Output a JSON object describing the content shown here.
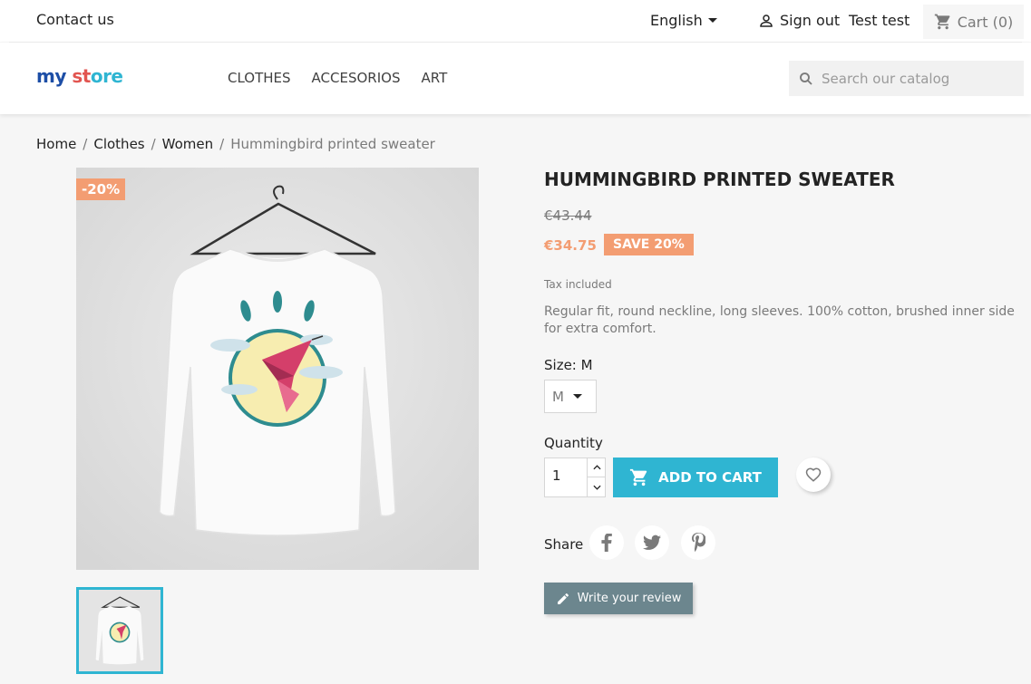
{
  "header": {
    "contact": "Contact us",
    "language": "English",
    "sign_out": "Sign out",
    "user_name": "Test test",
    "cart": "Cart (0)"
  },
  "nav": {
    "logo_part1": "my",
    "logo_part2": "st",
    "logo_part3": "ore",
    "menu": [
      "CLOTHES",
      "ACCESORIOS",
      "ART"
    ],
    "search_placeholder": "Search our catalog"
  },
  "breadcrumb": [
    "Home",
    "Clothes",
    "Women",
    "Hummingbird printed sweater"
  ],
  "product": {
    "discount_badge": "-20%",
    "title": "HUMMINGBIRD PRINTED SWEATER",
    "old_price": "€43.44",
    "price": "€34.75",
    "save_label": "SAVE 20%",
    "tax": "Tax included",
    "description": "Regular fit, round neckline, long sleeves. 100% cotton, brushed inner side for extra comfort.",
    "size_label": "Size: M",
    "size_selected": "M",
    "quantity_label": "Quantity",
    "quantity_value": "1",
    "add_to_cart": "ADD TO CART",
    "share_label": "Share",
    "write_review": "Write your review"
  },
  "colors": {
    "accent": "#2fb5d2",
    "discount": "#f39d72",
    "review_button": "#6c868e"
  },
  "icons": [
    "user-icon",
    "cart-icon",
    "search-icon",
    "heart-icon",
    "facebook-icon",
    "twitter-icon",
    "pinterest-icon",
    "pencil-icon"
  ]
}
